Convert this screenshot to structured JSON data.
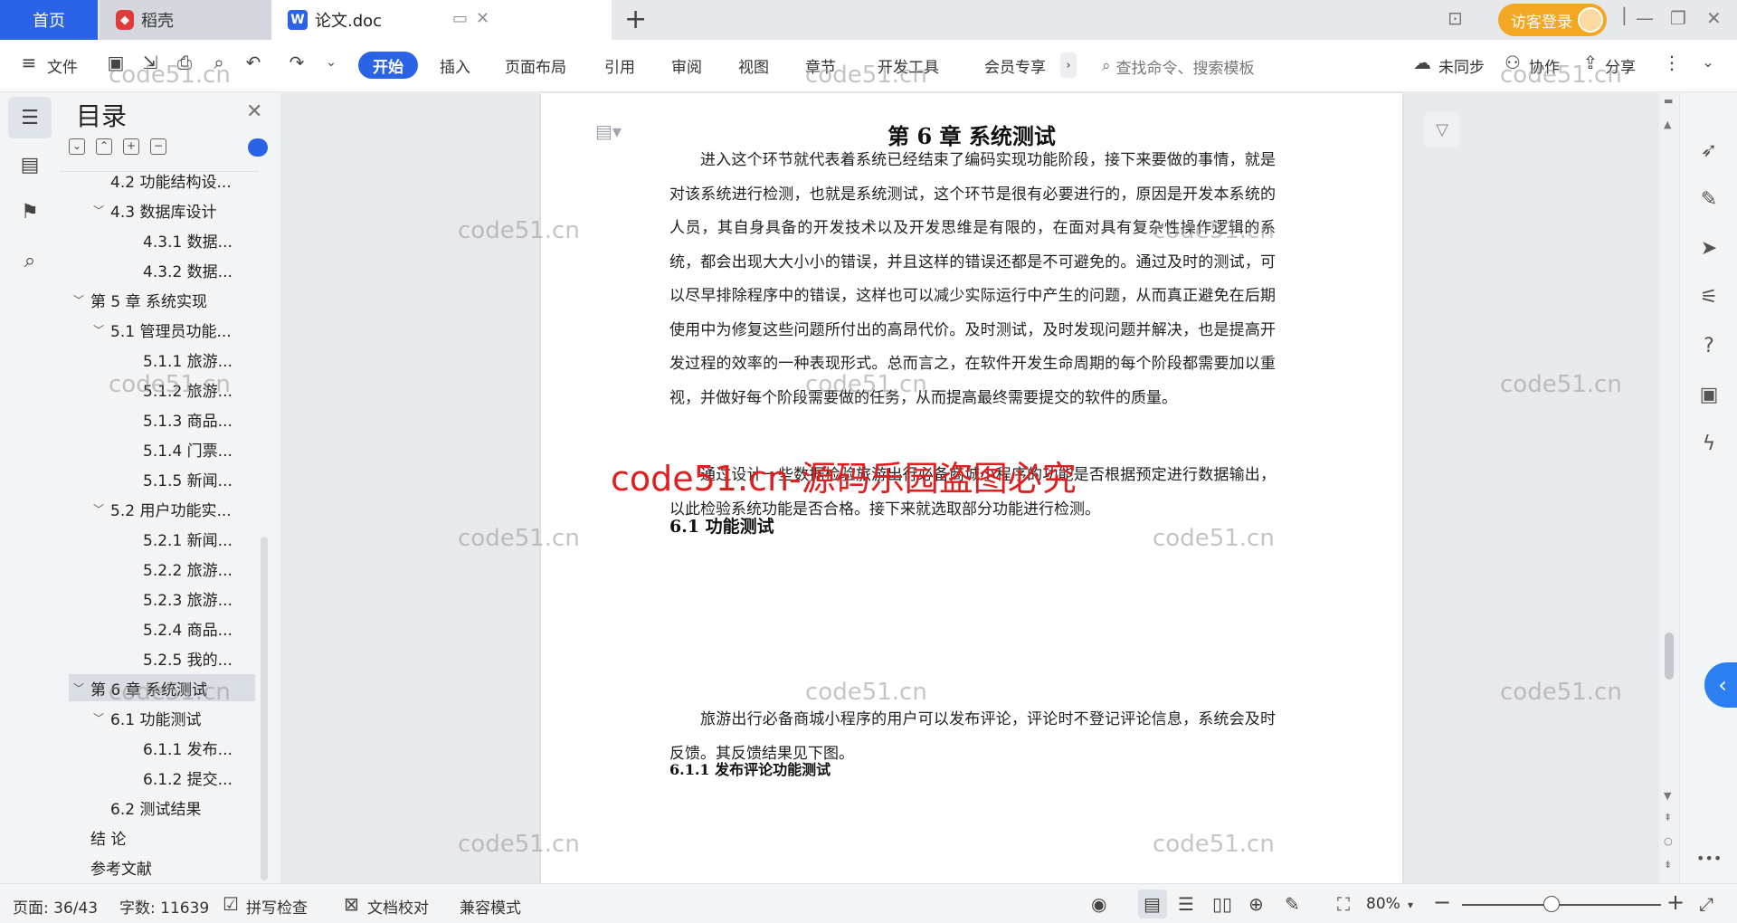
{
  "tabs": {
    "home": "首页",
    "daoke": "稻壳",
    "doc": "论文.doc"
  },
  "window": {
    "login": "访客登录"
  },
  "ribbon": {
    "file": "文件",
    "tabs": [
      "开始",
      "插入",
      "页面布局",
      "引用",
      "审阅",
      "视图",
      "章节",
      "开发工具",
      "会员专享"
    ],
    "search_placeholder": "查找命令、搜索模板",
    "sync": "未同步",
    "collab": "协作",
    "share": "分享"
  },
  "toc": {
    "title": "目录",
    "items": [
      {
        "label": "4.2  功能结构设...",
        "level": 2,
        "chev": ""
      },
      {
        "label": "4.3  数据库设计",
        "level": 2,
        "chev": "v"
      },
      {
        "label": "4.3.1  数据...",
        "level": 3,
        "chev": ""
      },
      {
        "label": "4.3.2  数据...",
        "level": 3,
        "chev": ""
      },
      {
        "label": "第 5 章  系统实现",
        "level": 1,
        "chev": "v"
      },
      {
        "label": "5.1  管理员功能...",
        "level": 2,
        "chev": "v"
      },
      {
        "label": "5.1.1  旅游...",
        "level": 3,
        "chev": ""
      },
      {
        "label": "5.1.2  旅游...",
        "level": 3,
        "chev": ""
      },
      {
        "label": "5.1.3  商品...",
        "level": 3,
        "chev": ""
      },
      {
        "label": "5.1.4  门票...",
        "level": 3,
        "chev": ""
      },
      {
        "label": "5.1.5  新闻...",
        "level": 3,
        "chev": ""
      },
      {
        "label": "5.2  用户功能实...",
        "level": 2,
        "chev": "v"
      },
      {
        "label": "5.2.1  新闻...",
        "level": 3,
        "chev": ""
      },
      {
        "label": "5.2.2  旅游...",
        "level": 3,
        "chev": ""
      },
      {
        "label": "5.2.3  旅游...",
        "level": 3,
        "chev": ""
      },
      {
        "label": "5.2.4  商品...",
        "level": 3,
        "chev": ""
      },
      {
        "label": "5.2.5  我的...",
        "level": 3,
        "chev": ""
      },
      {
        "label": "第 6 章  系统测试",
        "level": 1,
        "chev": "v",
        "selected": true
      },
      {
        "label": "6.1  功能测试",
        "level": 2,
        "chev": "v"
      },
      {
        "label": "6.1.1  发布...",
        "level": 3,
        "chev": ""
      },
      {
        "label": "6.1.2  提交...",
        "level": 3,
        "chev": ""
      },
      {
        "label": "6.2  测试结果",
        "level": 2,
        "chev": ""
      },
      {
        "label": "结    论",
        "level": 1,
        "chev": ""
      },
      {
        "label": "参考文献",
        "level": 1,
        "chev": ""
      }
    ]
  },
  "document": {
    "chapter_title": "第 6 章  系统测试",
    "intro": "进入这个环节就代表着系统已经结束了编码实现功能阶段，接下来要做的事情，就是对该系统进行检测，也就是系统测试，这个环节是很有必要进行的，原因是开发本系统的人员，其自身具备的开发技术以及开发思维是有限的，在面对具有复杂性操作逻辑的系统，都会出现大大小小的错误，并且这样的错误还都是不可避免的。通过及时的测试，可以尽早排除程序中的错误，这样也可以减少实际运行中产生的问题，从而真正避免在后期使用中为修复这些问题所付出的高昂代价。及时测试，及时发现问题并解决，也是提高开发过程的效率的一种表现形式。总而言之，在软件开发生命周期的每个阶段都需要加以重视，并做好每个阶段需要做的任务，从而提高最终需要提交的软件的质量。",
    "section_6_1": "6.1  功能测试",
    "section_6_1_text": "通过设计一些数据检验旅游出行必备商城小程序的功能是否根据预定进行数据输出，以此检验系统功能是否合格。接下来就选取部分功能进行检测。",
    "section_6_1_1": "6.1.1  发布评论功能测试",
    "section_6_1_1_text": "旅游出行必备商城小程序的用户可以发布评论，评论时不登记评论信息，系统会及时反馈。其反馈结果见下图。"
  },
  "watermarks": {
    "text": "code51.cn",
    "red": "code51.cn-源码乐园盗图必究"
  },
  "status": {
    "page": "页面: 36/43",
    "words": "字数: 11639",
    "spell": "拼写检查",
    "proof": "文档校对",
    "compat": "兼容模式",
    "zoom": "80%",
    "zoom_level": 0.45
  }
}
